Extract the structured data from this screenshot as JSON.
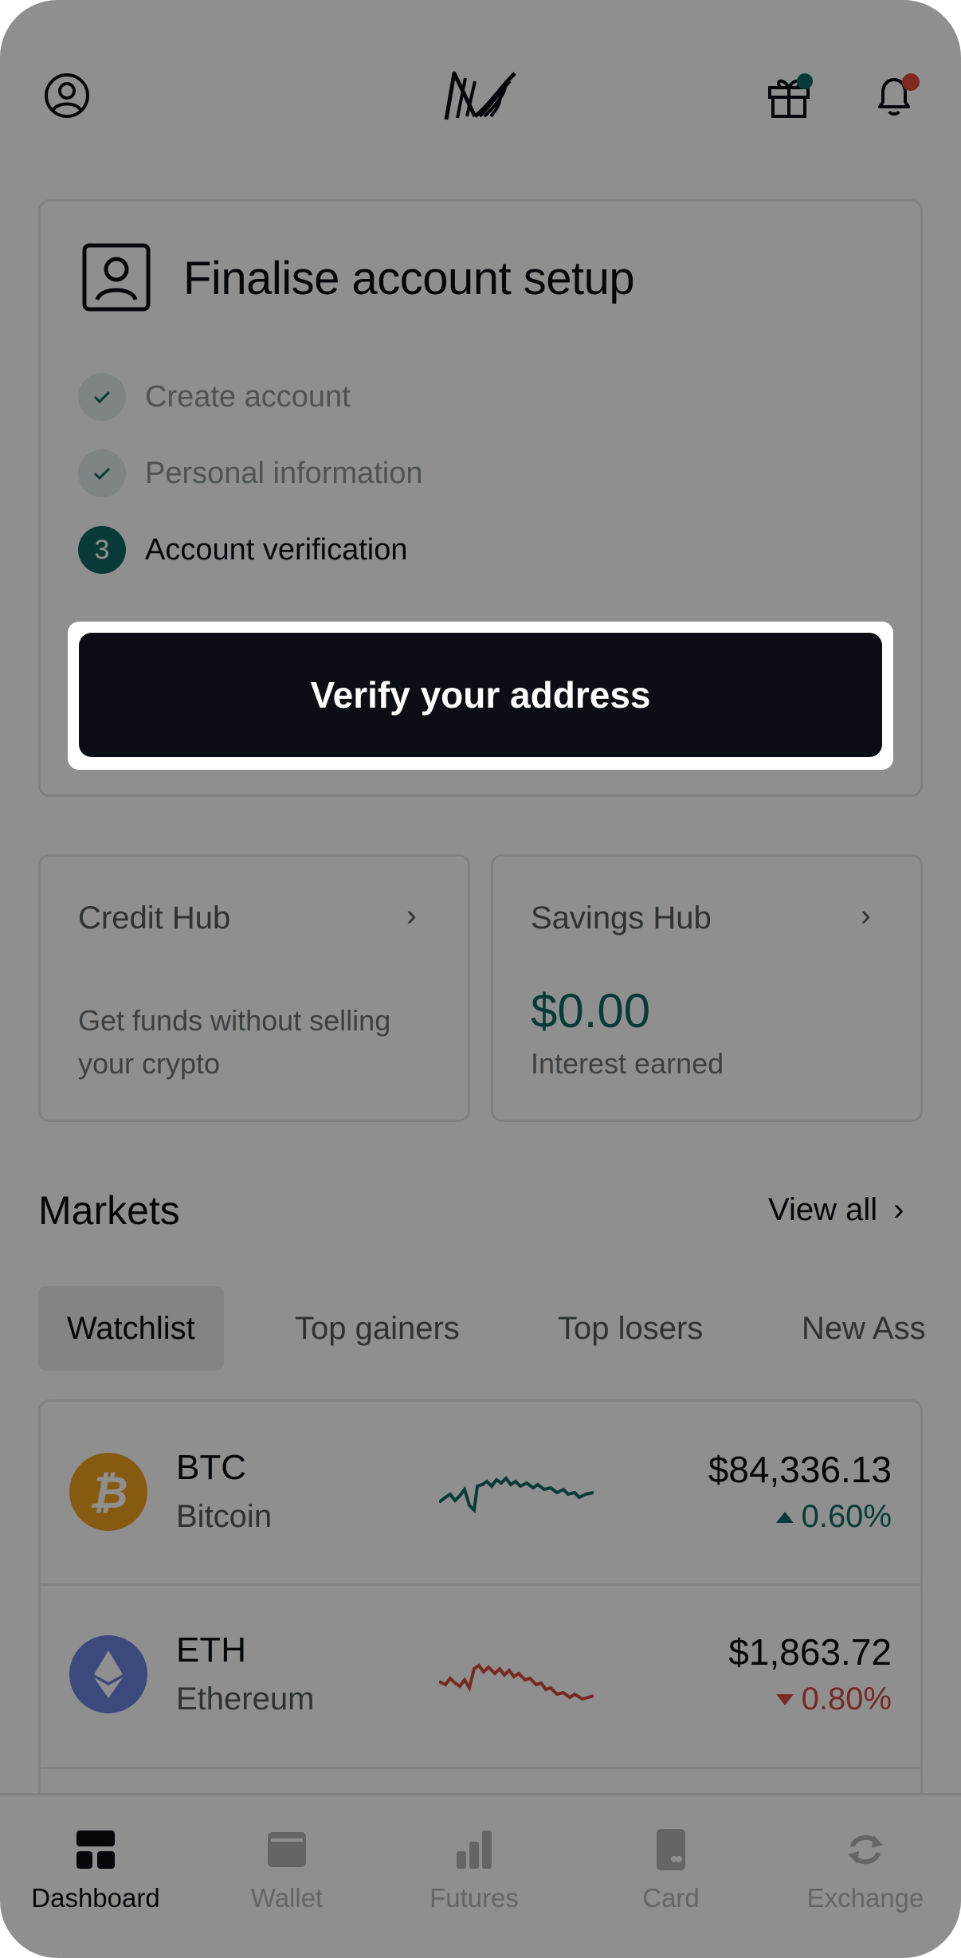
{
  "colors": {
    "accent": "#0f6a62",
    "negative": "#d24c3c",
    "notification_dot": "#e24a3c",
    "gift_dot": "#0f6a62",
    "btc": "#f0a121",
    "eth": "#6b83df",
    "dark": "#0b0d12"
  },
  "header": {
    "profile_icon": "user-circle-icon",
    "logo": "brand-logo",
    "gift_icon": "gift-icon",
    "bell_icon": "bell-icon"
  },
  "setup": {
    "title": "Finalise account setup",
    "icon": "id-card-icon",
    "steps": [
      {
        "label": "Create account",
        "status": "done"
      },
      {
        "label": "Personal information",
        "status": "done"
      },
      {
        "label": "Account verification",
        "status": "current",
        "number": "3"
      }
    ],
    "cta_label": "Verify your address"
  },
  "credit_hub": {
    "title": "Credit Hub",
    "description_line1": "Get funds without selling",
    "description_line2": "your crypto"
  },
  "savings_hub": {
    "title": "Savings Hub",
    "value": "$0.00",
    "caption": "Interest earned"
  },
  "markets": {
    "title": "Markets",
    "view_all": "View all",
    "tabs": [
      "Watchlist",
      "Top gainers",
      "Top losers",
      "New Ass"
    ],
    "active_tab": "Watchlist",
    "rows": [
      {
        "symbol": "BTC",
        "name": "Bitcoin",
        "price": "$84,336.13",
        "change": "0.60%",
        "direction": "up"
      },
      {
        "symbol": "ETH",
        "name": "Ethereum",
        "price": "$1,863.72",
        "change": "0.80%",
        "direction": "down"
      }
    ]
  },
  "nav": {
    "items": [
      "Dashboard",
      "Wallet",
      "Futures",
      "Card",
      "Exchange"
    ],
    "active": "Dashboard"
  }
}
